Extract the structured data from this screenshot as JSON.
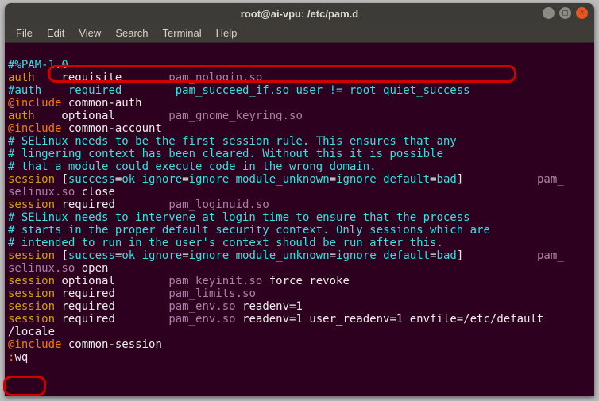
{
  "window": {
    "title": "root@ai-vpu: /etc/pam.d"
  },
  "menu": {
    "file": "File",
    "edit": "Edit",
    "view": "View",
    "search": "Search",
    "terminal": "Terminal",
    "help": "Help"
  },
  "term": {
    "l1": {
      "a": "#%PAM-1.0"
    },
    "l2": {
      "a": "auth",
      "b": "    requisite       ",
      "c": "pam_nologin.so"
    },
    "l3": {
      "a": "#",
      "b": "auth    required        pam_succeed_if.so user != root quiet_success"
    },
    "l4": {
      "a": "@include",
      "b": " common-auth"
    },
    "l5": {
      "a": "auth",
      "b": "    optional        ",
      "c": "pam_gnome_keyring.so"
    },
    "l6": {
      "a": "@include",
      "b": " common-account"
    },
    "l7": {
      "a": "# SELinux needs to be the first session rule. This ensures that any"
    },
    "l8": {
      "a": "# lingering context has been cleared. Without this it is possible"
    },
    "l9": {
      "a": "# that a module could execute code in the wrong domain."
    },
    "l10": {
      "a": "session",
      "b": " [",
      "c": "success",
      "d": "=",
      "e": "ok ignore",
      "f": "=",
      "g": "ignore module_unknown",
      "h": "=",
      "i": "ignore default",
      "j": "=",
      "k": "bad",
      "l": "]           ",
      "m": "pam_"
    },
    "l11": {
      "a": "selinux.so",
      "b": " close"
    },
    "l12": {
      "a": "session",
      "b": " required        ",
      "c": "pam_loginuid.so"
    },
    "l13": {
      "a": "# SELinux needs to intervene at login time to ensure that the process"
    },
    "l14": {
      "a": "# starts in the proper default security context. Only sessions which are"
    },
    "l15": {
      "a": "# intended to run in the user's context should be run after this."
    },
    "l16": {
      "a": "session",
      "b": " [",
      "c": "success",
      "d": "=",
      "e": "ok ignore",
      "f": "=",
      "g": "ignore module_unknown",
      "h": "=",
      "i": "ignore default",
      "j": "=",
      "k": "bad",
      "l": "]           ",
      "m": "pam_"
    },
    "l17": {
      "a": "selinux.so",
      "b": " open"
    },
    "l18": {
      "a": "session",
      "b": " optional        ",
      "c": "pam_keyinit.so",
      "d": " force revoke"
    },
    "l19": {
      "a": "session",
      "b": " required        ",
      "c": "pam_limits.so"
    },
    "l20": {
      "a": "session",
      "b": " required        ",
      "c": "pam_env.so",
      "d": " readenv=1"
    },
    "l21": {
      "a": "session",
      "b": " required        ",
      "c": "pam_env.so",
      "d": " readenv=1 user_readenv=1 envfile=/etc/default"
    },
    "l22": {
      "a": "/locale"
    },
    "l23": {
      "a": "@include",
      "b": " common-session"
    },
    "l24": {
      "a": ":",
      "b": "wq"
    }
  }
}
